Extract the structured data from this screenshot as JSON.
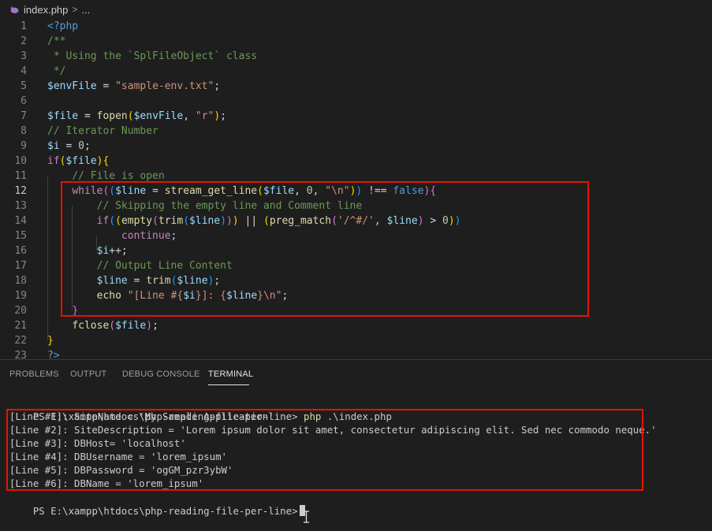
{
  "breadcrumb": {
    "file": "index.php",
    "separator": ">",
    "more": "..."
  },
  "editor": {
    "lines": [
      {
        "n": "1",
        "tokens": [
          [
            "c-tag",
            "<?php"
          ]
        ]
      },
      {
        "n": "2",
        "tokens": [
          [
            "c-com",
            "/**"
          ]
        ]
      },
      {
        "n": "3",
        "tokens": [
          [
            "c-com",
            " * Using the `SplFileObject` class"
          ]
        ]
      },
      {
        "n": "4",
        "tokens": [
          [
            "c-com",
            " */"
          ]
        ]
      },
      {
        "n": "5",
        "tokens": [
          [
            "c-var",
            "$envFile"
          ],
          [
            "c-op",
            " = "
          ],
          [
            "c-str",
            "\"sample-env.txt\""
          ],
          [
            "c-op",
            ";"
          ]
        ]
      },
      {
        "n": "6",
        "tokens": []
      },
      {
        "n": "7",
        "tokens": [
          [
            "c-var",
            "$file"
          ],
          [
            "c-op",
            " = "
          ],
          [
            "c-fn",
            "fopen"
          ],
          [
            "c-br1",
            "("
          ],
          [
            "c-var",
            "$envFile"
          ],
          [
            "c-op",
            ", "
          ],
          [
            "c-str",
            "\"r\""
          ],
          [
            "c-br1",
            ")"
          ],
          [
            "c-op",
            ";"
          ]
        ]
      },
      {
        "n": "8",
        "tokens": [
          [
            "c-com",
            "// Iterator Number"
          ]
        ]
      },
      {
        "n": "9",
        "tokens": [
          [
            "c-var",
            "$i"
          ],
          [
            "c-op",
            " = "
          ],
          [
            "c-num",
            "0"
          ],
          [
            "c-op",
            ";"
          ]
        ]
      },
      {
        "n": "10",
        "tokens": [
          [
            "c-kw",
            "if"
          ],
          [
            "c-br1",
            "("
          ],
          [
            "c-var",
            "$file"
          ],
          [
            "c-br1",
            ")"
          ],
          [
            "c-br1",
            "{"
          ]
        ]
      },
      {
        "n": "11",
        "tokens": [
          [
            "c-op",
            "    "
          ],
          [
            "c-com",
            "// File is open"
          ]
        ]
      },
      {
        "n": "12",
        "tokens": [
          [
            "c-op",
            "    "
          ],
          [
            "c-kw",
            "while"
          ],
          [
            "c-br2",
            "("
          ],
          [
            "c-br3",
            "("
          ],
          [
            "c-var",
            "$line"
          ],
          [
            "c-op",
            " = "
          ],
          [
            "c-fn",
            "stream_get_line"
          ],
          [
            "c-br1",
            "("
          ],
          [
            "c-var",
            "$file"
          ],
          [
            "c-op",
            ", "
          ],
          [
            "c-num",
            "0"
          ],
          [
            "c-op",
            ", "
          ],
          [
            "c-str",
            "\"\\n\""
          ],
          [
            "c-br1",
            ")"
          ],
          [
            "c-br3",
            ")"
          ],
          [
            "c-op",
            " !== "
          ],
          [
            "c-bool",
            "false"
          ],
          [
            "c-br2",
            ")"
          ],
          [
            "c-br2",
            "{"
          ]
        ]
      },
      {
        "n": "13",
        "tokens": [
          [
            "c-op",
            "        "
          ],
          [
            "c-com",
            "// Skipping the empty line and Comment line"
          ]
        ]
      },
      {
        "n": "14",
        "tokens": [
          [
            "c-op",
            "        "
          ],
          [
            "c-kw",
            "if"
          ],
          [
            "c-br3",
            "("
          ],
          [
            "c-br1",
            "("
          ],
          [
            "c-fn",
            "empty"
          ],
          [
            "c-br2",
            "("
          ],
          [
            "c-fn",
            "trim"
          ],
          [
            "c-br3",
            "("
          ],
          [
            "c-var",
            "$line"
          ],
          [
            "c-br3",
            ")"
          ],
          [
            "c-br2",
            ")"
          ],
          [
            "c-br1",
            ")"
          ],
          [
            "c-op",
            " || "
          ],
          [
            "c-br1",
            "("
          ],
          [
            "c-fn",
            "preg_match"
          ],
          [
            "c-br2",
            "("
          ],
          [
            "c-str",
            "'/^#/'"
          ],
          [
            "c-op",
            ", "
          ],
          [
            "c-var",
            "$line"
          ],
          [
            "c-br2",
            ")"
          ],
          [
            "c-op",
            " > "
          ],
          [
            "c-num",
            "0"
          ],
          [
            "c-br1",
            ")"
          ],
          [
            "c-br3",
            ")"
          ]
        ]
      },
      {
        "n": "15",
        "tokens": [
          [
            "c-op",
            "            "
          ],
          [
            "c-kw",
            "continue"
          ],
          [
            "c-op",
            ";"
          ]
        ]
      },
      {
        "n": "16",
        "tokens": [
          [
            "c-op",
            "        "
          ],
          [
            "c-var",
            "$i"
          ],
          [
            "c-op",
            "++;"
          ]
        ]
      },
      {
        "n": "17",
        "tokens": [
          [
            "c-op",
            "        "
          ],
          [
            "c-com",
            "// Output Line Content"
          ]
        ]
      },
      {
        "n": "18",
        "tokens": [
          [
            "c-op",
            "        "
          ],
          [
            "c-var",
            "$line"
          ],
          [
            "c-op",
            " = "
          ],
          [
            "c-fn",
            "trim"
          ],
          [
            "c-br3",
            "("
          ],
          [
            "c-var",
            "$line"
          ],
          [
            "c-br3",
            ")"
          ],
          [
            "c-op",
            ";"
          ]
        ]
      },
      {
        "n": "19",
        "tokens": [
          [
            "c-op",
            "        "
          ],
          [
            "c-fn",
            "echo"
          ],
          [
            "c-op",
            " "
          ],
          [
            "c-str",
            "\"[Line #{"
          ],
          [
            "c-var",
            "$i"
          ],
          [
            "c-str",
            "}]: {"
          ],
          [
            "c-var",
            "$line"
          ],
          [
            "c-str",
            "}\\n\""
          ],
          [
            "c-op",
            ";"
          ]
        ]
      },
      {
        "n": "20",
        "tokens": [
          [
            "c-op",
            "    "
          ],
          [
            "c-br2",
            "}"
          ]
        ]
      },
      {
        "n": "21",
        "tokens": [
          [
            "c-op",
            "    "
          ],
          [
            "c-fn",
            "fclose"
          ],
          [
            "c-br2",
            "("
          ],
          [
            "c-var",
            "$file"
          ],
          [
            "c-br2",
            ")"
          ],
          [
            "c-op",
            ";"
          ]
        ]
      },
      {
        "n": "22",
        "tokens": [
          [
            "c-br1",
            "}"
          ]
        ]
      },
      {
        "n": "23",
        "tokens": [
          [
            "c-tag",
            "?>"
          ]
        ]
      }
    ],
    "active_line": "12"
  },
  "panel": {
    "tabs": [
      "PROBLEMS",
      "OUTPUT",
      "DEBUG CONSOLE",
      "TERMINAL"
    ],
    "active_tab": "TERMINAL"
  },
  "terminal": {
    "prompt": "PS E:\\xampp\\htdocs\\php-reading-file-per-line> ",
    "command": "php",
    "args": " .\\index.php",
    "output": [
      "[Line #1]: SiteName = 'My Sample Application'",
      "[Line #2]: SiteDescription = 'Lorem ipsum dolor sit amet, consectetur adipiscing elit. Sed nec commodo neque.'",
      "[Line #3]: DBHost= 'localhost'",
      "[Line #4]: DBUsername = 'lorem_ipsum'",
      "[Line #5]: DBPassword = 'ogGM_pzr3ybW'",
      "[Line #6]: DBName = 'lorem_ipsum'"
    ],
    "final_prompt": "PS E:\\xampp\\htdocs\\php-reading-file-per-line>"
  },
  "colors": {
    "highlight_box": "#e51400",
    "background": "#1e1e1e"
  }
}
